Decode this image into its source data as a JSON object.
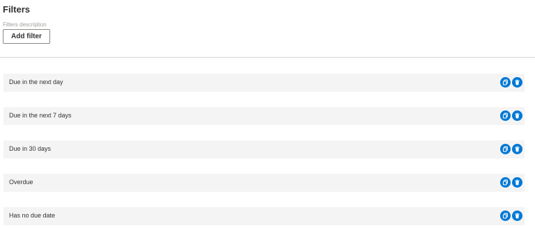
{
  "header": {
    "title": "Filters",
    "description": "Filters description",
    "add_filter_label": "Add filter"
  },
  "filters": [
    {
      "label": "Due in the next day",
      "copy_icon": "copy-icon",
      "delete_icon": "trash-icon"
    },
    {
      "label": "Due in the next 7 days",
      "copy_icon": "copy-icon",
      "delete_icon": "trash-icon"
    },
    {
      "label": "Due in 30 days",
      "copy_icon": "copy-icon",
      "delete_icon": "trash-icon"
    },
    {
      "label": "Overdue",
      "copy_icon": "copy-icon",
      "delete_icon": "trash-icon"
    },
    {
      "label": "Has no due date",
      "copy_icon": "copy-icon",
      "delete_icon": "trash-icon"
    }
  ],
  "colors": {
    "accent": "#0078d4",
    "row_background": "#f4f4f4",
    "description": "#a19f9d"
  }
}
